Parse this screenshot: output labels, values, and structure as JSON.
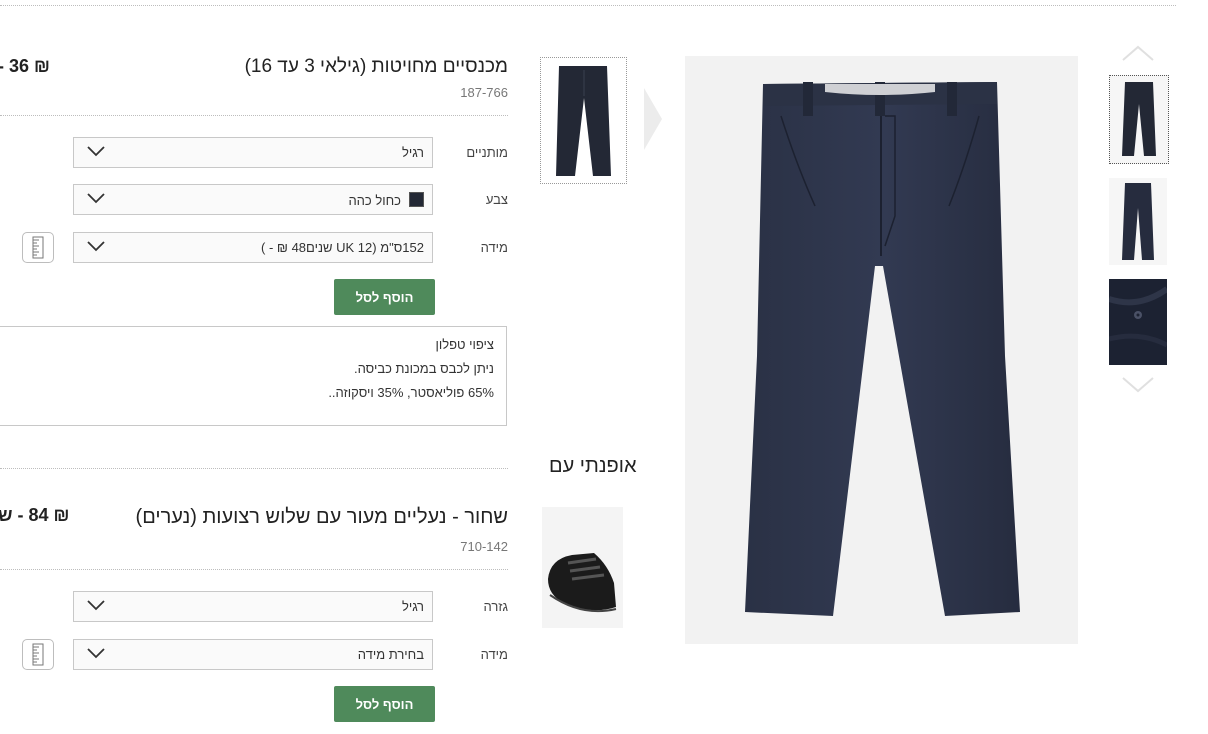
{
  "product1": {
    "title": "מכנסיים מחויטות (גילאי 3 עד 16)",
    "code": "187-766",
    "price": "₪ 36 -",
    "options": [
      {
        "label": "מותניים",
        "value": "רגיל"
      },
      {
        "label": "צבע",
        "value": "כחול כהה"
      },
      {
        "label": "מידה",
        "value": "152ס\"מ (UK 12 שנים48 ₪ - )"
      }
    ],
    "add_button": "הוסף לסל",
    "description": [
      "ציפוי טפלון",
      "ניתן לכבס במכונת כביסה.",
      "65% פוליאסטר, 35% ויסקוזה.."
    ]
  },
  "product2": {
    "title": "שחור - נעליים מעור עם שלוש רצועות (נערים)",
    "code": "710-142",
    "price": "₪ 84 - ש",
    "options": [
      {
        "label": "גזרה",
        "value": "רגיל"
      },
      {
        "label": "מידה",
        "value": "בחירת מידה"
      }
    ],
    "add_button": "הוסף לסל"
  },
  "recommend_title": "אופנתי עם",
  "colors": {
    "accent_green": "#4f8a5b",
    "navy": "#232835"
  }
}
